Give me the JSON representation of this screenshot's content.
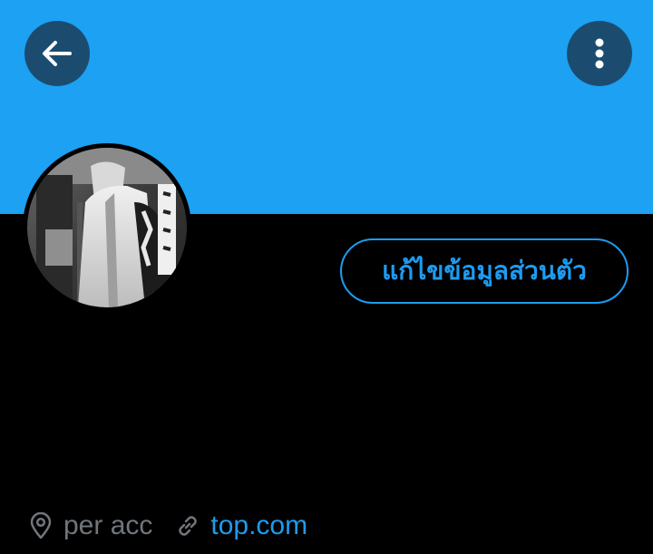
{
  "colors": {
    "banner": "#1da1f2",
    "background": "#000000",
    "accent": "#1d9bf0",
    "muted": "#71767b",
    "header_button": "#1b4c6f"
  },
  "header": {
    "back_icon": "arrow-left-icon",
    "more_icon": "more-vertical-icon"
  },
  "profile": {
    "avatar_icon": "profile-photo",
    "edit_profile_label": "แก้ไขข้อมูลส่วนตัว",
    "location": "per acc",
    "location_icon": "location-pin-icon",
    "website": "top.com",
    "website_icon": "link-icon"
  }
}
